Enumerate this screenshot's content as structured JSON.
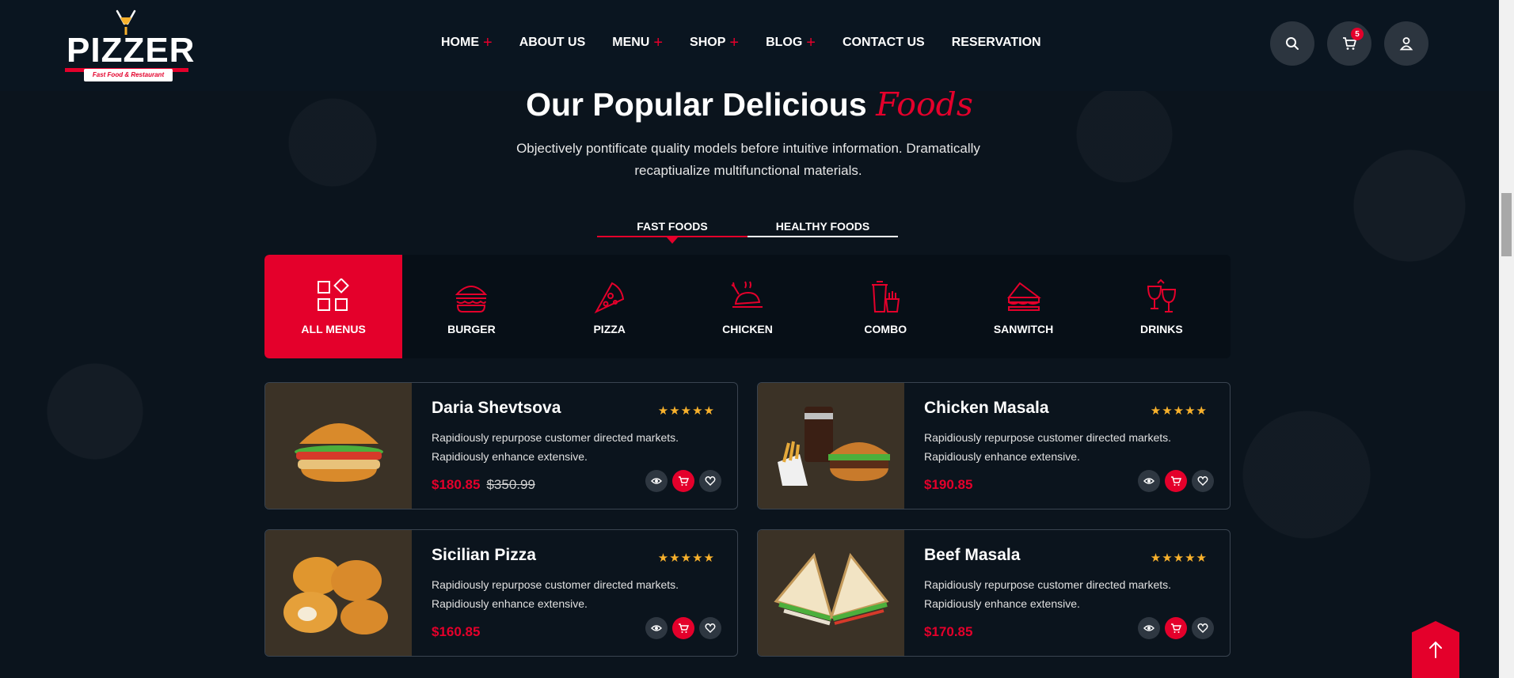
{
  "brand": {
    "name": "PIZZER",
    "tagline": "Fast Food & Restaurant"
  },
  "nav": {
    "items": [
      {
        "label": "HOME",
        "plus": "+"
      },
      {
        "label": "ABOUT US",
        "plus": ""
      },
      {
        "label": "MENU",
        "plus": "+"
      },
      {
        "label": "SHOP",
        "plus": "+"
      },
      {
        "label": "BLOG",
        "plus": "+"
      },
      {
        "label": "CONTACT US",
        "plus": ""
      },
      {
        "label": "RESERVATION",
        "plus": ""
      }
    ]
  },
  "header": {
    "cart_count": "5",
    "search_icon": "search-icon",
    "cart_icon": "cart-icon",
    "user_icon": "user-icon"
  },
  "section": {
    "title": "Our Popular Delicious",
    "title_accent": "Foods",
    "description": "Objectively pontificate quality models before intuitive information. Dramatically recaptiualize multifunctional materials."
  },
  "food_tabs": [
    {
      "label": "FAST FOODS"
    },
    {
      "label": "HEALTHY FOODS"
    }
  ],
  "categories": [
    {
      "label": "ALL MENUS",
      "icon": "grid-icon"
    },
    {
      "label": "BURGER",
      "icon": "burger-icon"
    },
    {
      "label": "PIZZA",
      "icon": "pizza-icon"
    },
    {
      "label": "CHICKEN",
      "icon": "chicken-icon"
    },
    {
      "label": "COMBO",
      "icon": "combo-icon"
    },
    {
      "label": "SANWITCH",
      "icon": "sandwich-icon"
    },
    {
      "label": "DRINKS",
      "icon": "drinks-icon"
    }
  ],
  "products": [
    {
      "name": "Daria Shevtsova",
      "rating": "★★★★★",
      "desc": "Rapidiously repurpose customer directed markets. Rapidiously enhance extensive.",
      "price": "$180.85",
      "old_price": "$350.99"
    },
    {
      "name": "Chicken Masala",
      "rating": "★★★★★",
      "desc": "Rapidiously repurpose customer directed markets. Rapidiously enhance extensive.",
      "price": "$190.85",
      "old_price": ""
    },
    {
      "name": "Sicilian Pizza",
      "rating": "★★★★★",
      "desc": "Rapidiously repurpose customer directed markets. Rapidiously enhance extensive.",
      "price": "$160.85",
      "old_price": ""
    },
    {
      "name": "Beef Masala",
      "rating": "★★★★★",
      "desc": "Rapidiously repurpose customer directed markets. Rapidiously enhance extensive.",
      "price": "$170.85",
      "old_price": ""
    }
  ],
  "colors": {
    "accent": "#e4002b",
    "background": "#0b141d",
    "star": "#f8b12c"
  }
}
